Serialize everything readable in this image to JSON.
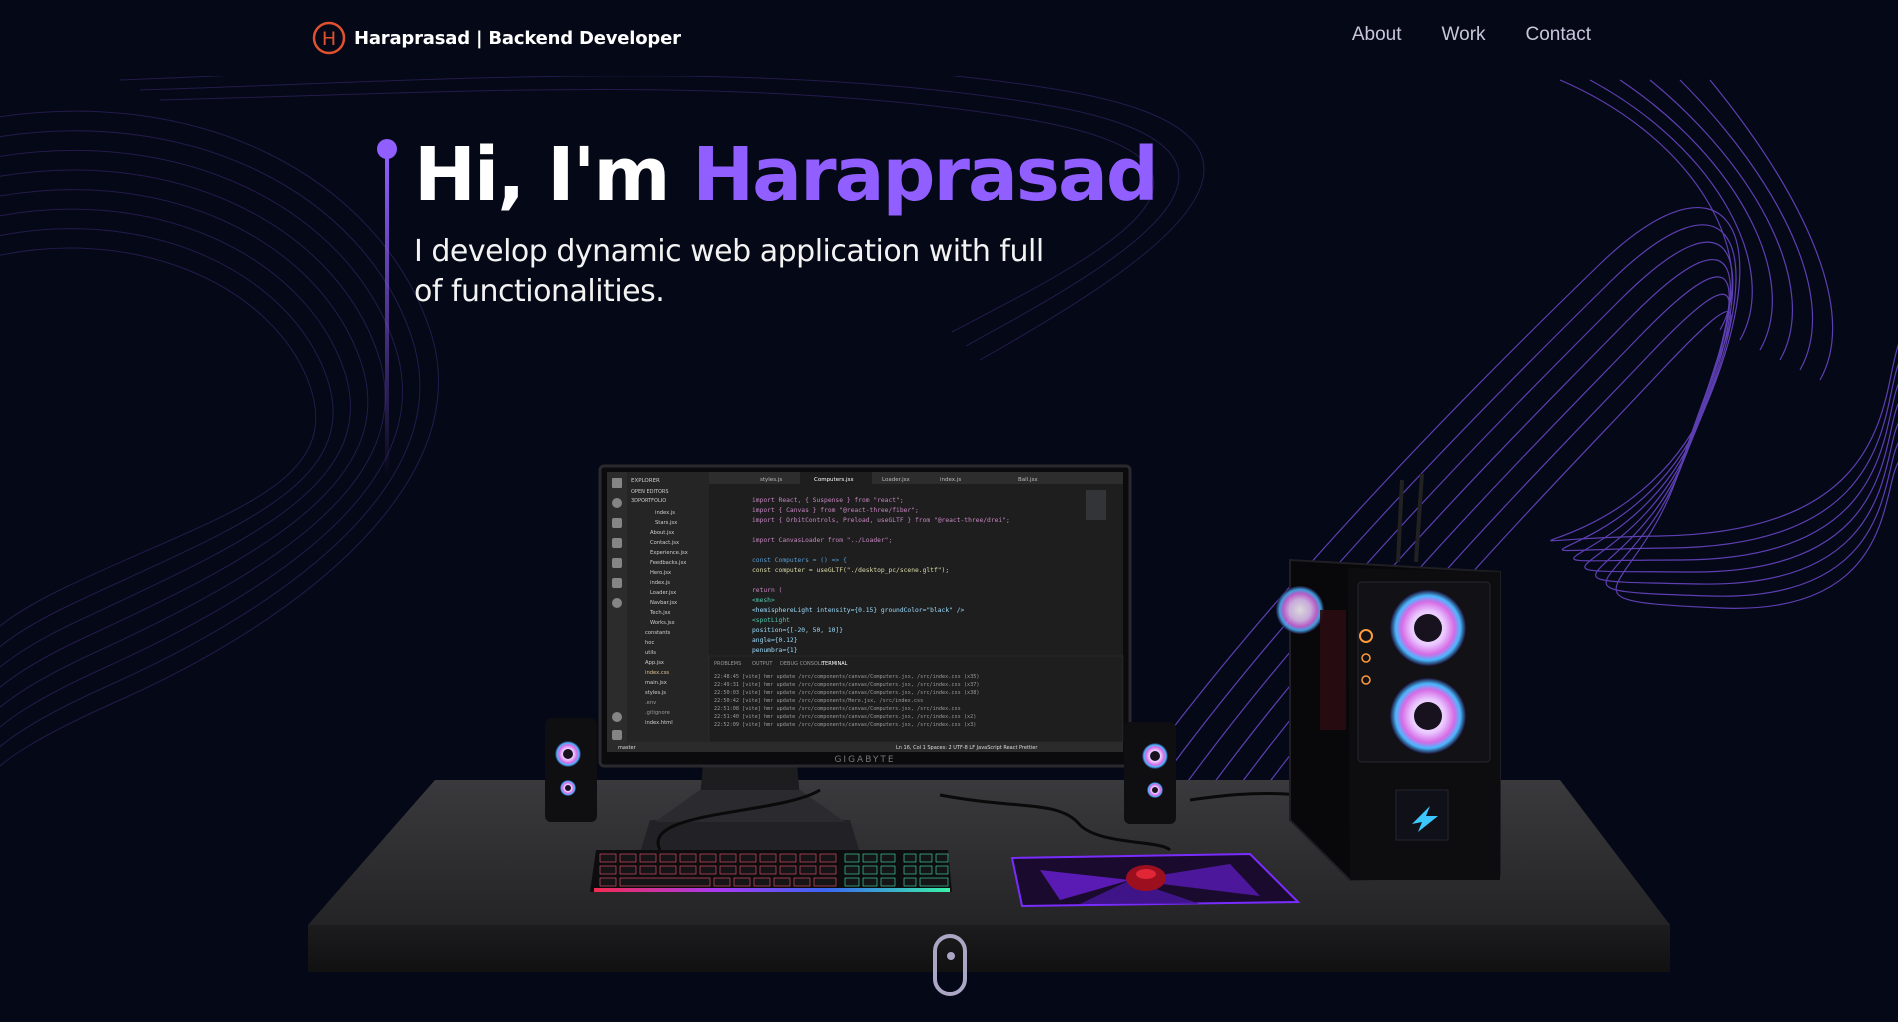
{
  "nav": {
    "brand_name": "Haraprasad",
    "brand_role": "| Backend Developer",
    "logo_letter": "H",
    "links": [
      "About",
      "Work",
      "Contact"
    ]
  },
  "hero": {
    "greeting": "Hi, I'm ",
    "name": "Haraprasad",
    "subtitle": "I develop dynamic web application with full of functionalities."
  },
  "scene": {
    "monitor_brand": "GIGABYTE",
    "editor": {
      "explorer_label": "EXPLORER",
      "open_editors": "OPEN EDITORS",
      "project": "3DPORTFOLIO",
      "files": [
        "index.js",
        "Stars.jsx",
        "About.jsx",
        "Contact.jsx",
        "Experience.jsx",
        "Feedbacks.jsx",
        "Hero.jsx",
        "index.js",
        "Loader.jsx",
        "Navbar.jsx",
        "Tech.jsx",
        "Works.jsx",
        "constants",
        "hoc",
        "utils",
        "App.jsx",
        "index.css",
        "main.jsx",
        "styles.js",
        ".env",
        ".gitignore",
        "index.html"
      ],
      "tabs": [
        "styles.js",
        "Computers.jsx",
        "Loader.jsx",
        "index.js",
        "Ball.jsx"
      ],
      "code_lines": [
        "import React, { Suspense } from \"react\";",
        "import { Canvas } from \"@react-three/fiber\";",
        "import { OrbitControls, Preload, useGLTF } from \"@react-three/drei\";",
        "",
        "import CanvasLoader from \"../Loader\";",
        "",
        "const Computers = () => {",
        "  const computer = useGLTF(\"./desktop_pc/scene.gltf\");",
        "",
        "  return (",
        "    <mesh>",
        "      <hemisphereLight intensity={0.15} groundColor=\"black\" />",
        "      <spotLight",
        "        position={[-20, 50, 10]}",
        "        angle={0.12}",
        "        penumbra={1}"
      ],
      "panel_tabs": [
        "PROBLEMS",
        "OUTPUT",
        "DEBUG CONSOLE",
        "TERMINAL"
      ],
      "terminal_lines": [
        "22:48:45 [vite] hmr update /src/components/canvas/Computers.jsx, /src/index.css (x35)",
        "22:49:31 [vite] hmr update /src/components/canvas/Computers.jsx, /src/index.css (x37)",
        "22:50:03 [vite] hmr update /src/components/canvas/Computers.jsx, /src/index.css (x38)",
        "22:50:42 [vite] hmr update /src/components/Hero.jsx, /src/index.css",
        "22:51:08 [vite] hmr update /src/components/canvas/Computers.jsx, /src/index.css",
        "22:51:40 [vite] hmr update /src/components/canvas/Computers.jsx, /src/index.css (x2)",
        "22:52:09 [vite] hmr update /src/components/canvas/Computers.jsx, /src/index.css (x3)"
      ],
      "status_left": "master",
      "status_right": "Ln 16, Col 1   Spaces: 2   UTF-8   LF   JavaScript React   Prettier"
    }
  },
  "colors": {
    "background": "#050816",
    "accent": "#915eff",
    "nav_text": "#c9c6dc",
    "scroll_indicator": "#aaa6c3"
  },
  "icons": {
    "logo": "h-circle-logo-icon",
    "scroll": "mouse-scroll-icon"
  }
}
